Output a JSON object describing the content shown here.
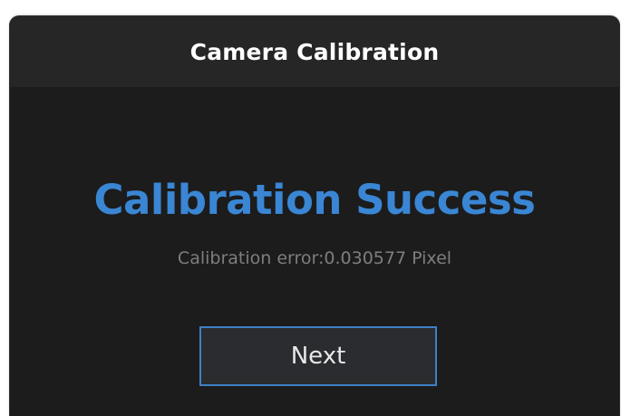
{
  "dialog": {
    "title": "Camera Calibration",
    "headline": "Calibration Success",
    "status_text": "Calibration error:0.030577 Pixel",
    "next_label": "Next"
  },
  "colors": {
    "accent": "#3a86d4",
    "button_border": "#3f7fc6",
    "background": "#1c1c1c",
    "titlebar": "#262626",
    "muted_text": "#7e7e7e"
  }
}
